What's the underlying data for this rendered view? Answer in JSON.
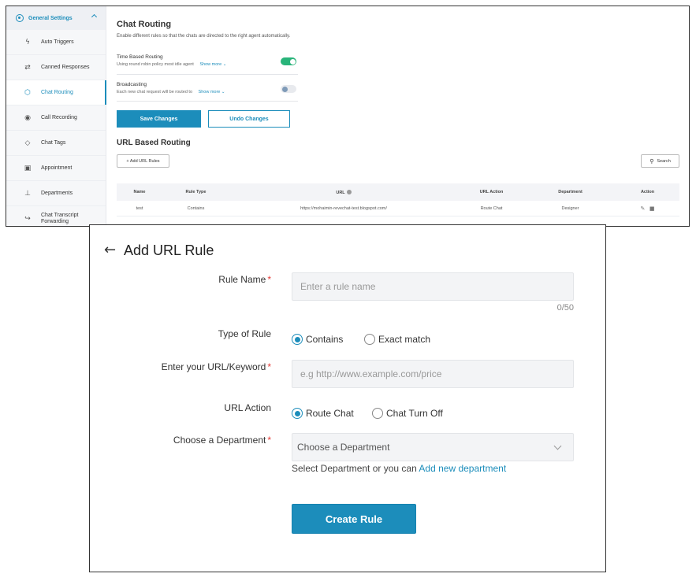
{
  "sidebar": {
    "section": "General Settings",
    "items": [
      {
        "label": "Auto Triggers",
        "icon": "lightning-icon"
      },
      {
        "label": "Canned Responses",
        "icon": "refresh-icon"
      },
      {
        "label": "Chat Routing",
        "icon": "routing-icon",
        "active": true
      },
      {
        "label": "Call Recording",
        "icon": "record-icon"
      },
      {
        "label": "Chat Tags",
        "icon": "tag-icon"
      },
      {
        "label": "Appointment",
        "icon": "calendar-icon"
      },
      {
        "label": "Departments",
        "icon": "org-chart-icon"
      },
      {
        "label": "Chat Transcript Forwarding",
        "icon": "forward-icon"
      }
    ]
  },
  "chat_routing": {
    "title": "Chat Routing",
    "subtitle": "Enable different rules so that the chats are directed to the right agent automatically.",
    "time_based": {
      "title": "Time Based Routing",
      "desc": "Using round robin policy most idle agent",
      "more": "Show more",
      "enabled": true
    },
    "broadcasting": {
      "title": "Broadcasting",
      "desc": "Each new chat request will be routed to",
      "more": "Show more",
      "enabled": false
    },
    "save_label": "Save Changes",
    "undo_label": "Undo Changes"
  },
  "url_routing": {
    "title": "URL Based Routing",
    "add_label": "+ Add URL Rules",
    "search_label": "Search",
    "columns": [
      "Name",
      "Rule Type",
      "URL",
      "URL Action",
      "Department",
      "Action"
    ],
    "rows": [
      {
        "name": "test",
        "rule_type": "Contains",
        "url": "https://mohaimin-revechat-test.blogspot.com/",
        "url_action": "Route Chat",
        "department": "Designer"
      }
    ]
  },
  "add_rule": {
    "title": "Add URL Rule",
    "rule_name_label": "Rule Name",
    "rule_name_placeholder": "Enter a rule name",
    "counter": "0/50",
    "type_label": "Type of Rule",
    "type_options": [
      "Contains",
      "Exact match"
    ],
    "type_selected": "Contains",
    "url_label": "Enter your URL/Keyword",
    "url_placeholder": "e.g http://www.example.com/price",
    "action_label": "URL Action",
    "action_options": [
      "Route Chat",
      "Chat Turn Off"
    ],
    "action_selected": "Route Chat",
    "dept_label": "Choose a Department",
    "dept_placeholder": "Choose a Department",
    "helper_text": "Select Department or you can",
    "helper_link": "Add new department",
    "create_label": "Create Rule",
    "required_mark": "*"
  },
  "colors": {
    "accent": "#1c8dbb",
    "toggle_on": "#29b47a",
    "required": "#e53935"
  }
}
